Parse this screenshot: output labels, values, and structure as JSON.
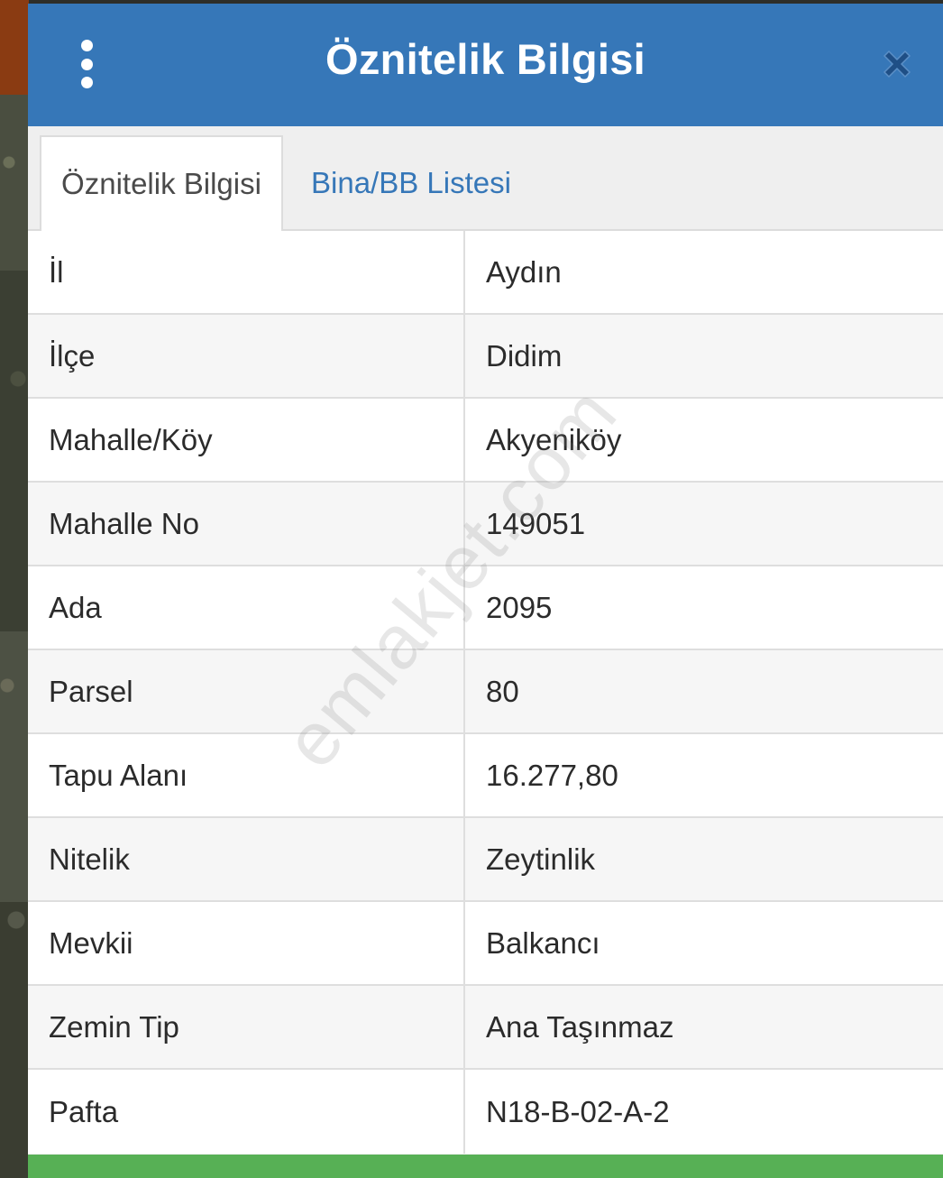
{
  "header": {
    "title": "Öznitelik Bilgisi"
  },
  "tabs": [
    {
      "label": "Öznitelik Bilgisi",
      "active": true
    },
    {
      "label": "Bina/BB Listesi",
      "active": false
    }
  ],
  "table": {
    "rows": [
      {
        "key": "İl",
        "value": "Aydın"
      },
      {
        "key": "İlçe",
        "value": "Didim"
      },
      {
        "key": "Mahalle/Köy",
        "value": "Akyeniköy"
      },
      {
        "key": "Mahalle No",
        "value": "149051"
      },
      {
        "key": "Ada",
        "value": "2095"
      },
      {
        "key": "Parsel",
        "value": "80"
      },
      {
        "key": "Tapu Alanı",
        "value": "16.277,80"
      },
      {
        "key": "Nitelik",
        "value": "Zeytinlik"
      },
      {
        "key": "Mevkii",
        "value": "Balkancı"
      },
      {
        "key": "Zemin Tip",
        "value": "Ana Taşınmaz"
      },
      {
        "key": "Pafta",
        "value": "N18-B-02-A-2"
      }
    ]
  },
  "watermark": "emlakjet.com",
  "colors": {
    "header": "#3677b8",
    "tab_link": "#3677b8",
    "footer_bar": "#57b055",
    "close_icon": "#1f4f86"
  },
  "icons": {
    "menu": "more-vertical-icon",
    "close": "close-icon"
  }
}
